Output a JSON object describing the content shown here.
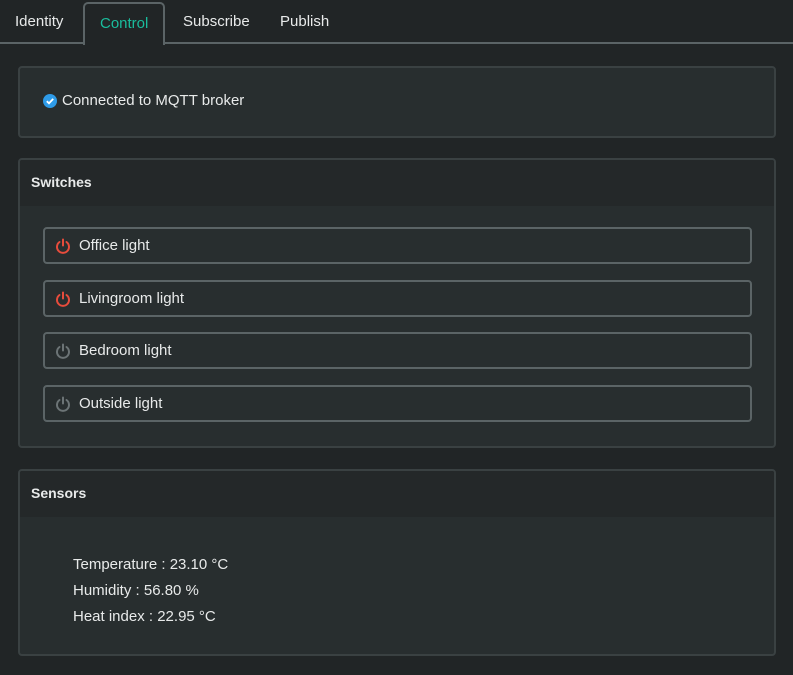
{
  "tabs": [
    {
      "label": "Identity"
    },
    {
      "label": "Control",
      "active": true
    },
    {
      "label": "Subscribe"
    },
    {
      "label": "Publish"
    }
  ],
  "status": {
    "text": "Connected to MQTT broker",
    "icon": "check-circle-icon",
    "color": "#2e9be8"
  },
  "switches": {
    "title": "Switches",
    "items": [
      {
        "label": "Office light",
        "state": "on"
      },
      {
        "label": "Livingroom light",
        "state": "on"
      },
      {
        "label": "Bedroom light",
        "state": "off"
      },
      {
        "label": "Outside light",
        "state": "off"
      }
    ],
    "on_color": "#e74c3c",
    "off_color": "#6c7476"
  },
  "sensors": {
    "title": "Sensors",
    "lines": [
      "Temperature : 23.10 °C",
      "Humidity : 56.80 %",
      "Heat index : 22.95 °C"
    ]
  },
  "accent": "#1abc9c"
}
